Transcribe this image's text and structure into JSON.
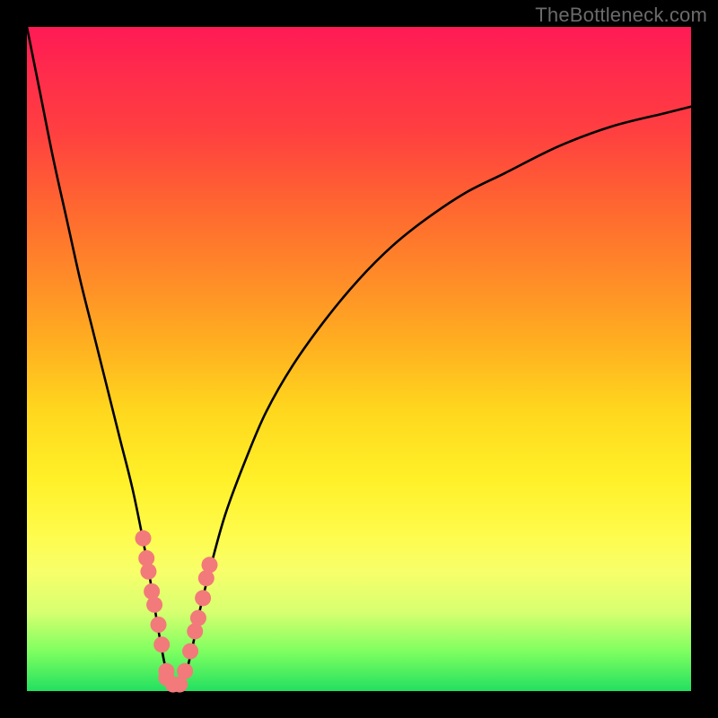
{
  "watermark": "TheBottleneck.com",
  "chart_data": {
    "type": "line",
    "title": "",
    "xlabel": "",
    "ylabel": "",
    "xlim": [
      0,
      100
    ],
    "ylim": [
      0,
      100
    ],
    "grid": false,
    "legend": false,
    "curve_color": "#000000",
    "marker_color": "#f27a7a",
    "series": [
      {
        "name": "bottleneck-curve",
        "x": [
          0,
          2,
          4,
          6,
          8,
          10,
          12,
          14,
          16,
          18,
          19,
          20,
          21,
          22,
          23,
          24,
          25,
          26,
          28,
          30,
          33,
          36,
          40,
          45,
          50,
          55,
          60,
          66,
          72,
          80,
          88,
          96,
          100
        ],
        "values": [
          100,
          90,
          80,
          71,
          62,
          54,
          46,
          38,
          30,
          20,
          14,
          8,
          3,
          1,
          1,
          3,
          7,
          12,
          20,
          27,
          35,
          42,
          49,
          56,
          62,
          67,
          71,
          75,
          78,
          82,
          85,
          87,
          88
        ]
      }
    ],
    "markers": {
      "name": "highlight-points",
      "x": [
        17.5,
        18.0,
        18.3,
        18.8,
        19.2,
        19.8,
        20.3,
        21.0,
        21.0,
        22.0,
        23.0,
        23.8,
        24.6,
        25.3,
        25.8,
        26.5,
        27.0,
        27.5
      ],
      "values": [
        23,
        20,
        18,
        15,
        13,
        10,
        7,
        3,
        2,
        1,
        1,
        3,
        6,
        9,
        11,
        14,
        17,
        19
      ]
    },
    "annotations": []
  },
  "colors": {
    "frame": "#000000",
    "watermark": "#6b6b6b"
  }
}
